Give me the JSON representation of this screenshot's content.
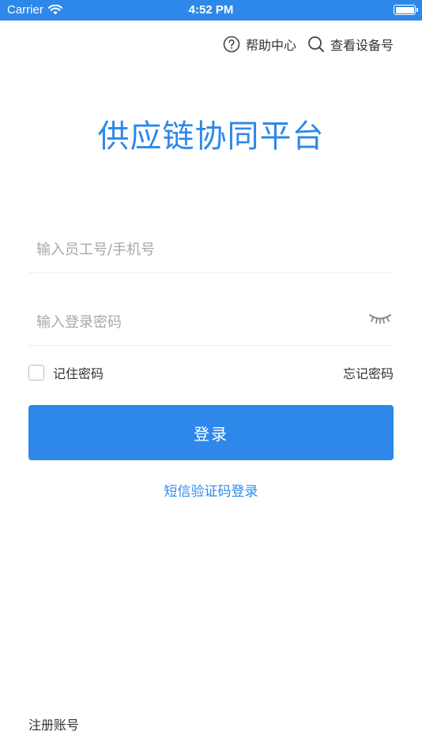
{
  "status_bar": {
    "carrier": "Carrier",
    "time": "4:52 PM",
    "icons": [
      "wifi-icon",
      "battery-icon"
    ]
  },
  "top_links": {
    "help": {
      "label": "帮助中心",
      "icon": "help-circle-icon"
    },
    "device": {
      "label": "查看设备号",
      "icon": "search-icon"
    }
  },
  "title": "供应链协同平台",
  "form": {
    "account_placeholder": "输入员工号/手机号",
    "account_value": "",
    "password_placeholder": "输入登录密码",
    "password_value": "",
    "password_toggle_icon": "eye-closed-icon",
    "remember_label": "记住密码",
    "remember_checked": false,
    "forgot_label": "忘记密码",
    "login_label": "登录",
    "sms_login_label": "短信验证码登录"
  },
  "register_label": "注册账号",
  "colors": {
    "accent": "#2e88ea",
    "text": "#333333",
    "placeholder": "#a8a8a8",
    "divider": "#eeeeee"
  }
}
